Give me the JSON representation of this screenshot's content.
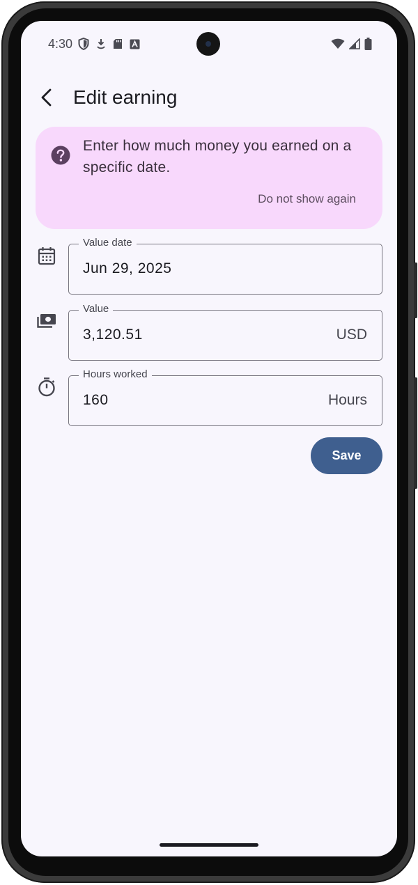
{
  "status_bar": {
    "time": "4:30",
    "left_icons": [
      "shield-icon",
      "download-icon",
      "sd-card-icon",
      "text-icon"
    ],
    "right_icons": [
      "wifi-icon",
      "signal-icon",
      "battery-icon"
    ]
  },
  "top_bar": {
    "back_icon": "arrow-back-icon",
    "title": "Edit earning"
  },
  "info_card": {
    "icon": "help-circle-icon",
    "message": "Enter how much money you earned on a specific date.",
    "dismiss_label": "Do not show again",
    "background_color": "#f8d8fc"
  },
  "fields": {
    "value_date": {
      "icon": "calendar-icon",
      "label": "Value date",
      "value": "Jun 29, 2025"
    },
    "value": {
      "icon": "money-icon",
      "label": "Value",
      "value": "3,120.51",
      "suffix": "USD"
    },
    "hours_worked": {
      "icon": "timer-icon",
      "label": "Hours worked",
      "value": "160",
      "suffix": "Hours"
    }
  },
  "actions": {
    "save_label": "Save",
    "save_color": "#3f5f8f"
  }
}
